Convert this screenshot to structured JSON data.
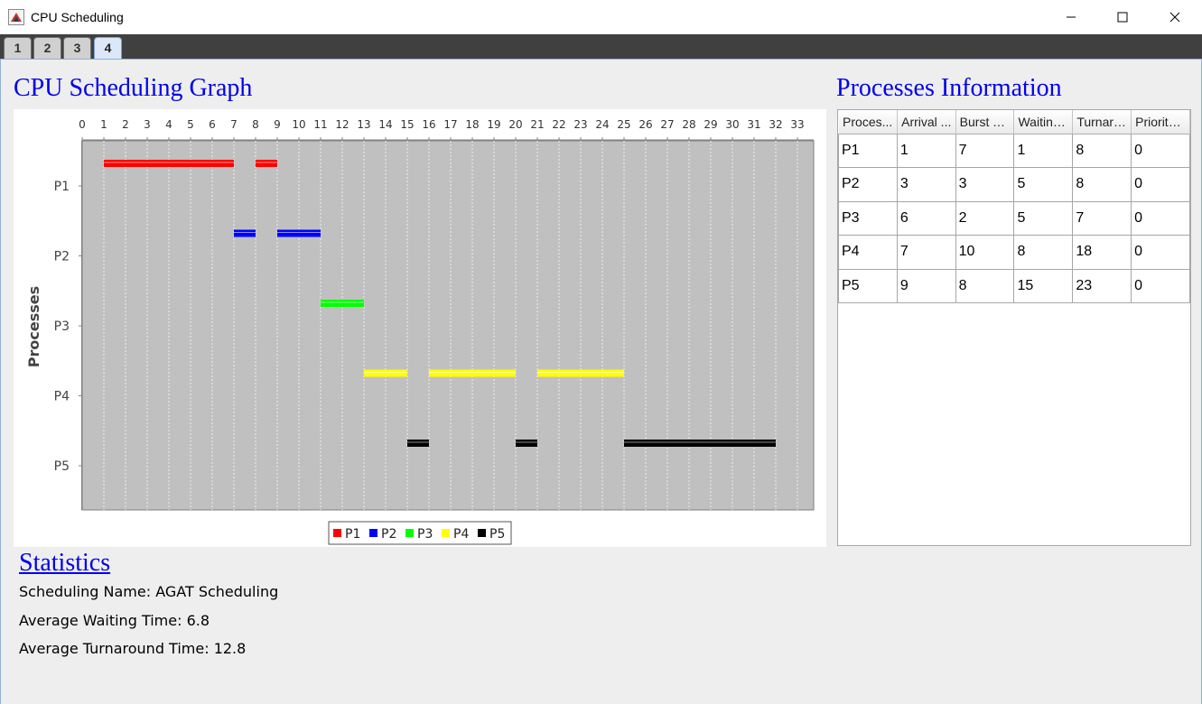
{
  "window": {
    "title": "CPU Scheduling",
    "app_icon": "java-app-icon",
    "controls": [
      "minimize-icon",
      "maximize-icon",
      "close-icon"
    ]
  },
  "tabs": [
    {
      "label": "1",
      "active": false
    },
    {
      "label": "2",
      "active": false
    },
    {
      "label": "3",
      "active": false
    },
    {
      "label": "4",
      "active": true
    }
  ],
  "graph": {
    "title": "CPU Scheduling Graph"
  },
  "chart_data": {
    "type": "gantt",
    "ylabel": "Processes",
    "xlim": [
      0,
      33
    ],
    "x_ticks": [
      "0",
      "1",
      "2",
      "3",
      "4",
      "5",
      "6",
      "7",
      "8",
      "9",
      "10",
      "11",
      "12",
      "13",
      "14",
      "15",
      "16",
      "17",
      "18",
      "19",
      "20",
      "21",
      "22",
      "23",
      "24",
      "25",
      "26",
      "27",
      "28",
      "29",
      "30",
      "31",
      "32",
      "33"
    ],
    "categories": [
      "P1",
      "P2",
      "P3",
      "P4",
      "P5"
    ],
    "background": "#c0c0c0",
    "series": [
      {
        "name": "P1",
        "color": "#ff0000",
        "intervals": [
          [
            1,
            7
          ],
          [
            8,
            9
          ]
        ]
      },
      {
        "name": "P2",
        "color": "#0000ff",
        "intervals": [
          [
            7,
            8
          ],
          [
            9,
            11
          ]
        ]
      },
      {
        "name": "P3",
        "color": "#00ff00",
        "intervals": [
          [
            11,
            13
          ]
        ]
      },
      {
        "name": "P4",
        "color": "#ffff00",
        "intervals": [
          [
            13,
            15
          ],
          [
            16,
            20
          ],
          [
            21,
            25
          ]
        ]
      },
      {
        "name": "P5",
        "color": "#000000",
        "intervals": [
          [
            15,
            16
          ],
          [
            20,
            21
          ],
          [
            25,
            32
          ]
        ]
      }
    ],
    "legend": [
      "P1",
      "P2",
      "P3",
      "P4",
      "P5"
    ],
    "legend_position": "bottom-center"
  },
  "processes_info": {
    "title": "Processes Information",
    "columns": [
      "Proces...",
      "Arrival ...",
      "Burst Ti...",
      "Waiting ...",
      "Turnaro...",
      "Priority ..."
    ],
    "rows": [
      [
        "P1",
        "1",
        "7",
        "1",
        "8",
        "0"
      ],
      [
        "P2",
        "3",
        "3",
        "5",
        "8",
        "0"
      ],
      [
        "P3",
        "6",
        "2",
        "5",
        "7",
        "0"
      ],
      [
        "P4",
        "7",
        "10",
        "8",
        "18",
        "0"
      ],
      [
        "P5",
        "9",
        "8",
        "15",
        "23",
        "0"
      ]
    ]
  },
  "statistics": {
    "title": "Statistics",
    "scheduling_name": "Scheduling Name: AGAT Scheduling",
    "avg_waiting": "Average Waiting Time: 6.8",
    "avg_turnaround": "Average Turnaround Time: 12.8"
  }
}
